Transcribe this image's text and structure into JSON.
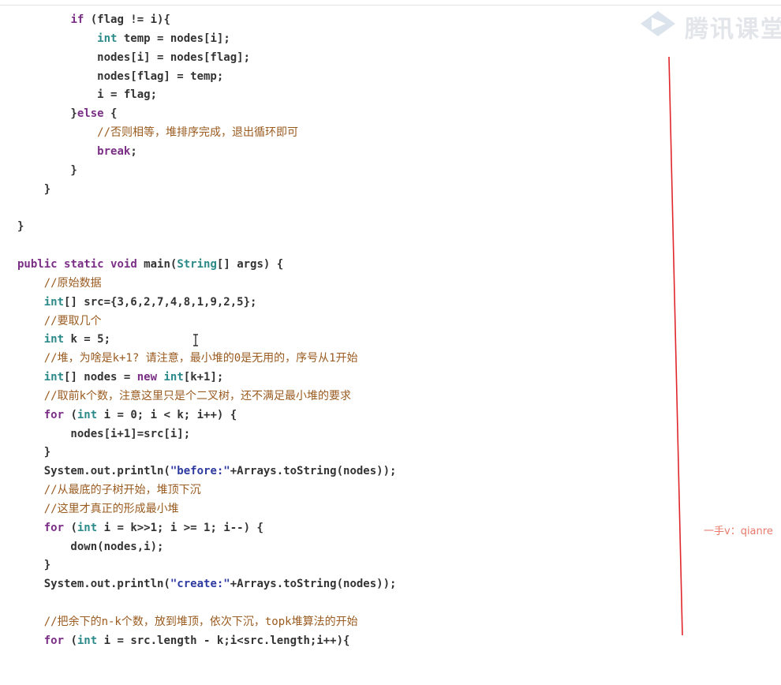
{
  "code": {
    "lines": [
      [
        {
          "t": "        "
        },
        {
          "t": "if",
          "c": "kw"
        },
        {
          "t": " (flag != i){"
        }
      ],
      [
        {
          "t": "            "
        },
        {
          "t": "int",
          "c": "ty"
        },
        {
          "t": " temp = nodes[i];"
        }
      ],
      [
        {
          "t": "            nodes[i] = nodes[flag];"
        }
      ],
      [
        {
          "t": "            nodes[flag] = temp;"
        }
      ],
      [
        {
          "t": "            i = flag;"
        }
      ],
      [
        {
          "t": "        }"
        },
        {
          "t": "else",
          "c": "kw"
        },
        {
          "t": " {"
        }
      ],
      [
        {
          "t": "            "
        },
        {
          "t": "//否则相等，堆排序完成，退出循环即可",
          "c": "cm"
        }
      ],
      [
        {
          "t": "            "
        },
        {
          "t": "break",
          "c": "kw"
        },
        {
          "t": ";"
        }
      ],
      [
        {
          "t": "        }"
        }
      ],
      [
        {
          "t": "    }"
        }
      ],
      [
        {
          "t": ""
        }
      ],
      [
        {
          "t": "}"
        }
      ],
      [
        {
          "t": ""
        }
      ],
      [
        {
          "t": "public",
          "c": "kw"
        },
        {
          "t": " "
        },
        {
          "t": "static",
          "c": "kw"
        },
        {
          "t": " "
        },
        {
          "t": "void",
          "c": "kw"
        },
        {
          "t": " main("
        },
        {
          "t": "String",
          "c": "ty"
        },
        {
          "t": "[] args) {"
        }
      ],
      [
        {
          "t": "    "
        },
        {
          "t": "//原始数据",
          "c": "cm"
        }
      ],
      [
        {
          "t": "    "
        },
        {
          "t": "int",
          "c": "ty"
        },
        {
          "t": "[] src={3,6,2,7,4,8,1,9,2,5};"
        }
      ],
      [
        {
          "t": "    "
        },
        {
          "t": "//要取几个",
          "c": "cm"
        }
      ],
      [
        {
          "t": "    "
        },
        {
          "t": "int",
          "c": "ty"
        },
        {
          "t": " k = 5;"
        }
      ],
      [
        {
          "t": "    "
        },
        {
          "t": "//堆，为啥是k+1? 请注意，最小堆的0是无用的，序号从1开始",
          "c": "cm"
        }
      ],
      [
        {
          "t": "    "
        },
        {
          "t": "int",
          "c": "ty"
        },
        {
          "t": "[] nodes = "
        },
        {
          "t": "new",
          "c": "kw"
        },
        {
          "t": " "
        },
        {
          "t": "int",
          "c": "ty"
        },
        {
          "t": "[k+1];"
        }
      ],
      [
        {
          "t": "    "
        },
        {
          "t": "//取前k个数，注意这里只是个二叉树，还不满足最小堆的要求",
          "c": "cm"
        }
      ],
      [
        {
          "t": "    "
        },
        {
          "t": "for",
          "c": "kw"
        },
        {
          "t": " ("
        },
        {
          "t": "int",
          "c": "ty"
        },
        {
          "t": " i = 0; i < k; i++) {"
        }
      ],
      [
        {
          "t": "        nodes[i+1]=src[i];"
        }
      ],
      [
        {
          "t": "    }"
        }
      ],
      [
        {
          "t": "    System.out.println("
        },
        {
          "t": "\"before:\"",
          "c": "st"
        },
        {
          "t": "+Arrays.toString(nodes));"
        }
      ],
      [
        {
          "t": "    "
        },
        {
          "t": "//从最底的子树开始，堆顶下沉",
          "c": "cm"
        }
      ],
      [
        {
          "t": "    "
        },
        {
          "t": "//这里才真正的形成最小堆",
          "c": "cm"
        }
      ],
      [
        {
          "t": "    "
        },
        {
          "t": "for",
          "c": "kw"
        },
        {
          "t": " ("
        },
        {
          "t": "int",
          "c": "ty"
        },
        {
          "t": " i = k>>1; i >= 1; i--) {"
        }
      ],
      [
        {
          "t": "        down(nodes,i);"
        }
      ],
      [
        {
          "t": "    }"
        }
      ],
      [
        {
          "t": "    System.out.println("
        },
        {
          "t": "\"create:\"",
          "c": "st"
        },
        {
          "t": "+Arrays.toString(nodes));"
        }
      ],
      [
        {
          "t": ""
        }
      ],
      [
        {
          "t": "    "
        },
        {
          "t": "//把余下的n-k个数，放到堆顶，依次下沉，topk堆算法的开始",
          "c": "cm"
        }
      ],
      [
        {
          "t": "    "
        },
        {
          "t": "for",
          "c": "kw"
        },
        {
          "t": " ("
        },
        {
          "t": "int",
          "c": "ty"
        },
        {
          "t": " i = src.length - k;i<src.length;i++){"
        }
      ]
    ]
  },
  "logo": {
    "text": "腾讯课堂",
    "icon": "tencent-classroom-play-icon"
  },
  "watermark": {
    "text": "一手v：qianre"
  },
  "annotation": {
    "color": "#e0262b"
  },
  "cursor": {
    "icon": "text-cursor-icon"
  }
}
